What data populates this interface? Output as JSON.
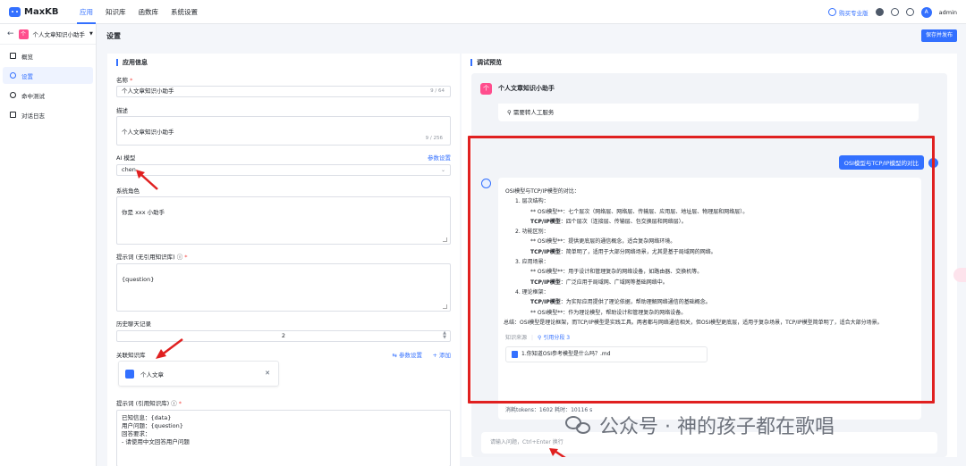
{
  "app": {
    "logo": "MaxKB"
  },
  "topnav": {
    "items": [
      "应用",
      "知识库",
      "函数库",
      "系统设置"
    ],
    "active": "应用"
  },
  "topright": {
    "pro": "购买专业版",
    "user": "admin"
  },
  "sidebar": {
    "app_name": "个人文章知识小助手",
    "app_icon_char": "个",
    "items": [
      {
        "label": "概览",
        "icon": "grid-icon"
      },
      {
        "label": "设置",
        "icon": "gear-icon",
        "active": true
      },
      {
        "label": "命中测试",
        "icon": "target-icon"
      },
      {
        "label": "对话日志",
        "icon": "log-icon"
      }
    ]
  },
  "page": {
    "title": "设置",
    "save_button": "保存并发布"
  },
  "settings": {
    "section_title": "应用信息",
    "name_label": "名称",
    "name_value": "个人文章知识小助手",
    "name_count": "9 / 64",
    "desc_label": "描述",
    "desc_value": "个人文章知识小助手",
    "desc_count": "9 / 256",
    "model_label": "AI 模型",
    "model_link": "参数设置",
    "model_value": "chen",
    "role_label": "系统角色",
    "role_value": "你是 xxx 小助手",
    "prompt_label": "提示词 (无引用知识库)",
    "prompt_value": "{question}",
    "history_label": "历史聊天记录",
    "history_value": "2",
    "kb_label": "关联知识库",
    "kb_param_link": "参数设置",
    "kb_add_link": "添加",
    "kb_item": "个人文章",
    "prompt2_label": "提示词 (引用知识库)",
    "prompt2_value": "已知信息：{data}\n用户问题：{question}\n回答要求：\n - 请使用中文回答用户问题"
  },
  "preview": {
    "section_title": "调试预览",
    "chat_title": "个人文章知识小助手",
    "chat_icon_char": "个",
    "human_service": "需要转人工服务",
    "user_message": "OSI模型与TCP/IP模型的对比",
    "answer": {
      "intro": "OSI模型与TCP/IP模型的对比：",
      "sections": [
        {
          "title": "1. 层次结构：",
          "lines": [
            {
              "k": "** OSI模型**",
              "v": "：七个层次（网络层、网络层、传输层、应用层、地址层、物理层和网络层）。"
            },
            {
              "k": "TCP/IP模型",
              "v": "：四个层次（连接层、传输层、包交换层和网络层）。"
            }
          ]
        },
        {
          "title": "2. 功能区别：",
          "lines": [
            {
              "k": "** OSI模型**",
              "v": "：提供更底层的通信概念，适合复杂网络环境。"
            },
            {
              "k": "TCP/IP模型",
              "v": "：简单明了，适用于大部分网络场景，尤其是基于局域网的网络。"
            }
          ]
        },
        {
          "title": "3. 应用场景：",
          "lines": [
            {
              "k": "** OSI模型**",
              "v": "：用于设计和管理复杂的网络设备，如路由器、交换机等。"
            },
            {
              "k": "TCP/IP模型",
              "v": "：广泛应用于局域网、广域网等基础网络中。"
            }
          ]
        },
        {
          "title": "4. 理论框架：",
          "lines": [
            {
              "k": "TCP/IP模型",
              "v": "：为实际应用提供了理论依据，帮助理解网络通信的基础概念。"
            },
            {
              "k": "** OSI模型**",
              "v": "：作为理论模型，帮助设计和管理复杂的网络设备。"
            }
          ]
        }
      ],
      "summary": "总结：OSI模型是理论框架，而TCP/IP模型是实践工具。两者都与网络通信相关，但OSI模型更底层，适用于复杂场景，TCP/IP模型简单明了，适合大部分场景。",
      "source_label": "知识来源",
      "source_link": "引用分段 3",
      "doc": "1.你知道OSI参考模型是什么吗？.md",
      "meta": "消耗tokens：1602  耗时：10116 s"
    },
    "input_placeholder": "请输入问题，Ctrl+Enter 换行"
  },
  "watermark": "公众号 · 神的孩子都在歌唱",
  "colors": {
    "accent": "#3370ff",
    "highlight": "#e02020",
    "app_icon": "#ff4d8d"
  }
}
